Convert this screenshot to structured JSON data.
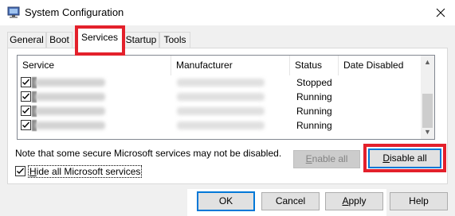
{
  "window": {
    "title": "System Configuration",
    "close_glyph": "✕"
  },
  "tabs": [
    {
      "label": "General"
    },
    {
      "label": "Boot"
    },
    {
      "label": "Services",
      "active": true
    },
    {
      "label": "Startup"
    },
    {
      "label": "Tools"
    }
  ],
  "services_table": {
    "columns": [
      "Service",
      "Manufacturer",
      "Status",
      "Date Disabled"
    ],
    "rows": [
      {
        "checked": true,
        "service": "",
        "manufacturer": "",
        "status": "Stopped",
        "date_disabled": ""
      },
      {
        "checked": true,
        "service": "",
        "manufacturer": "",
        "status": "Running",
        "date_disabled": ""
      },
      {
        "checked": true,
        "service": "",
        "manufacturer": "",
        "status": "Running",
        "date_disabled": ""
      },
      {
        "checked": true,
        "service": "",
        "manufacturer": "",
        "status": "Running",
        "date_disabled": ""
      }
    ],
    "scroll_up_glyph": "▲",
    "scroll_down_glyph": "▼"
  },
  "note": "Note that some secure Microsoft services may not be disabled.",
  "buttons": {
    "enable_all": {
      "text": "nable all",
      "accel": "E"
    },
    "disable_all": {
      "text": "isable all",
      "accel": "D"
    },
    "ok": "OK",
    "cancel": "Cancel",
    "apply": {
      "text": "pply",
      "accel": "A"
    },
    "help": "Help"
  },
  "hide_ms": {
    "checked": true,
    "accel": "H",
    "text": "ide all Microsoft services"
  },
  "colors": {
    "highlight_red": "#e3202b",
    "focus_blue": "#0078d7",
    "dialog_bg": "#f0f0f0"
  },
  "icons": [
    "system-config-app-icon",
    "close-icon",
    "checkbox-checked-icon",
    "scroll-up-icon",
    "scroll-down-icon"
  ]
}
